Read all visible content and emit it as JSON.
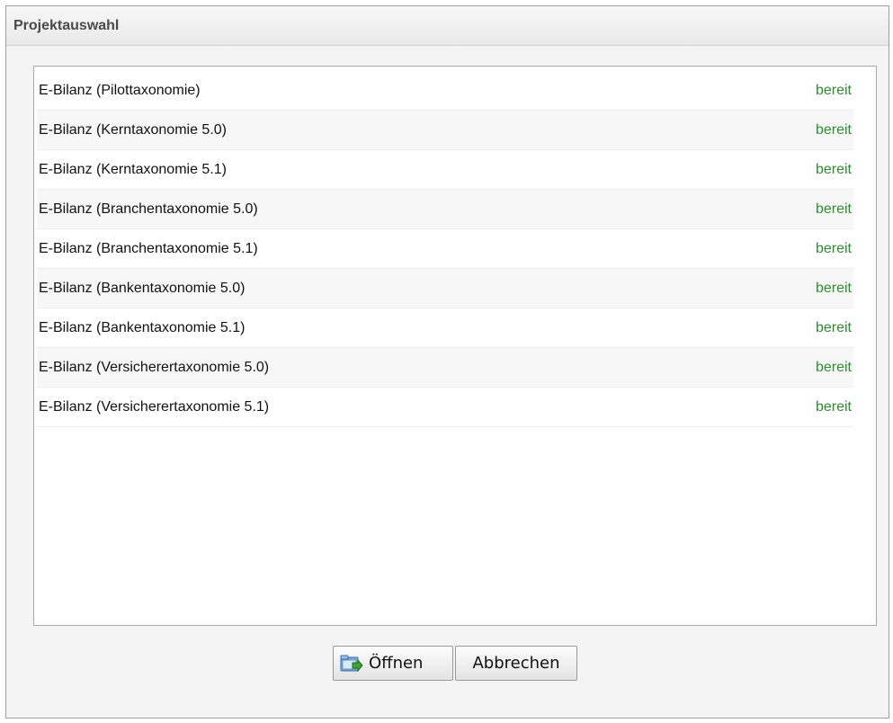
{
  "window": {
    "title": "Projektauswahl"
  },
  "projects": [
    {
      "name": "E-Bilanz (Pilottaxonomie)",
      "status": "bereit"
    },
    {
      "name": "E-Bilanz (Kerntaxonomie 5.0)",
      "status": "bereit"
    },
    {
      "name": "E-Bilanz (Kerntaxonomie 5.1)",
      "status": "bereit"
    },
    {
      "name": "E-Bilanz (Branchentaxonomie 5.0)",
      "status": "bereit"
    },
    {
      "name": "E-Bilanz (Branchentaxonomie 5.1)",
      "status": "bereit"
    },
    {
      "name": "E-Bilanz (Bankentaxonomie 5.0)",
      "status": "bereit"
    },
    {
      "name": "E-Bilanz (Bankentaxonomie 5.1)",
      "status": "bereit"
    },
    {
      "name": "E-Bilanz (Versicherertaxonomie 5.0)",
      "status": "bereit"
    },
    {
      "name": "E-Bilanz (Versicherertaxonomie 5.1)",
      "status": "bereit"
    }
  ],
  "buttons": {
    "open_label": "Öffnen",
    "open_icon": "folder-open-icon",
    "cancel_label": "Abbrechen"
  },
  "colors": {
    "status_ready": "#2e8b2e",
    "title_text": "#4a4a4a"
  }
}
